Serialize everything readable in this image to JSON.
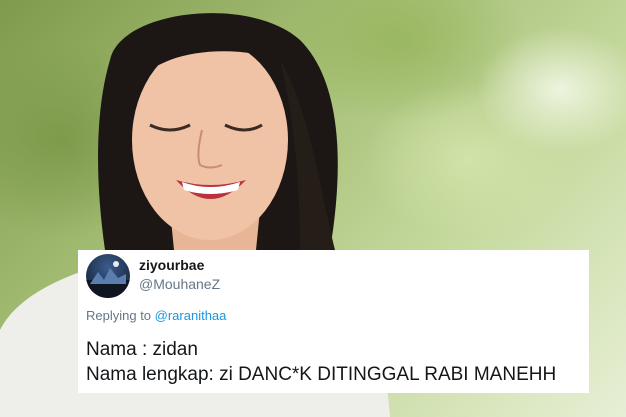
{
  "tweet": {
    "display_name": "ziyourbae",
    "handle": "@MouhaneZ",
    "replying_prefix": "Replying to ",
    "replying_to": "@raranithaa",
    "lines": [
      "Nama : zidan",
      "Nama lengkap: zi DANC*K DITINGGAL RABI MANEHH"
    ]
  },
  "colors": {
    "handle": "#657786",
    "link": "#1b95e0",
    "text": "#14171a",
    "card_bg": "#ffffff"
  }
}
